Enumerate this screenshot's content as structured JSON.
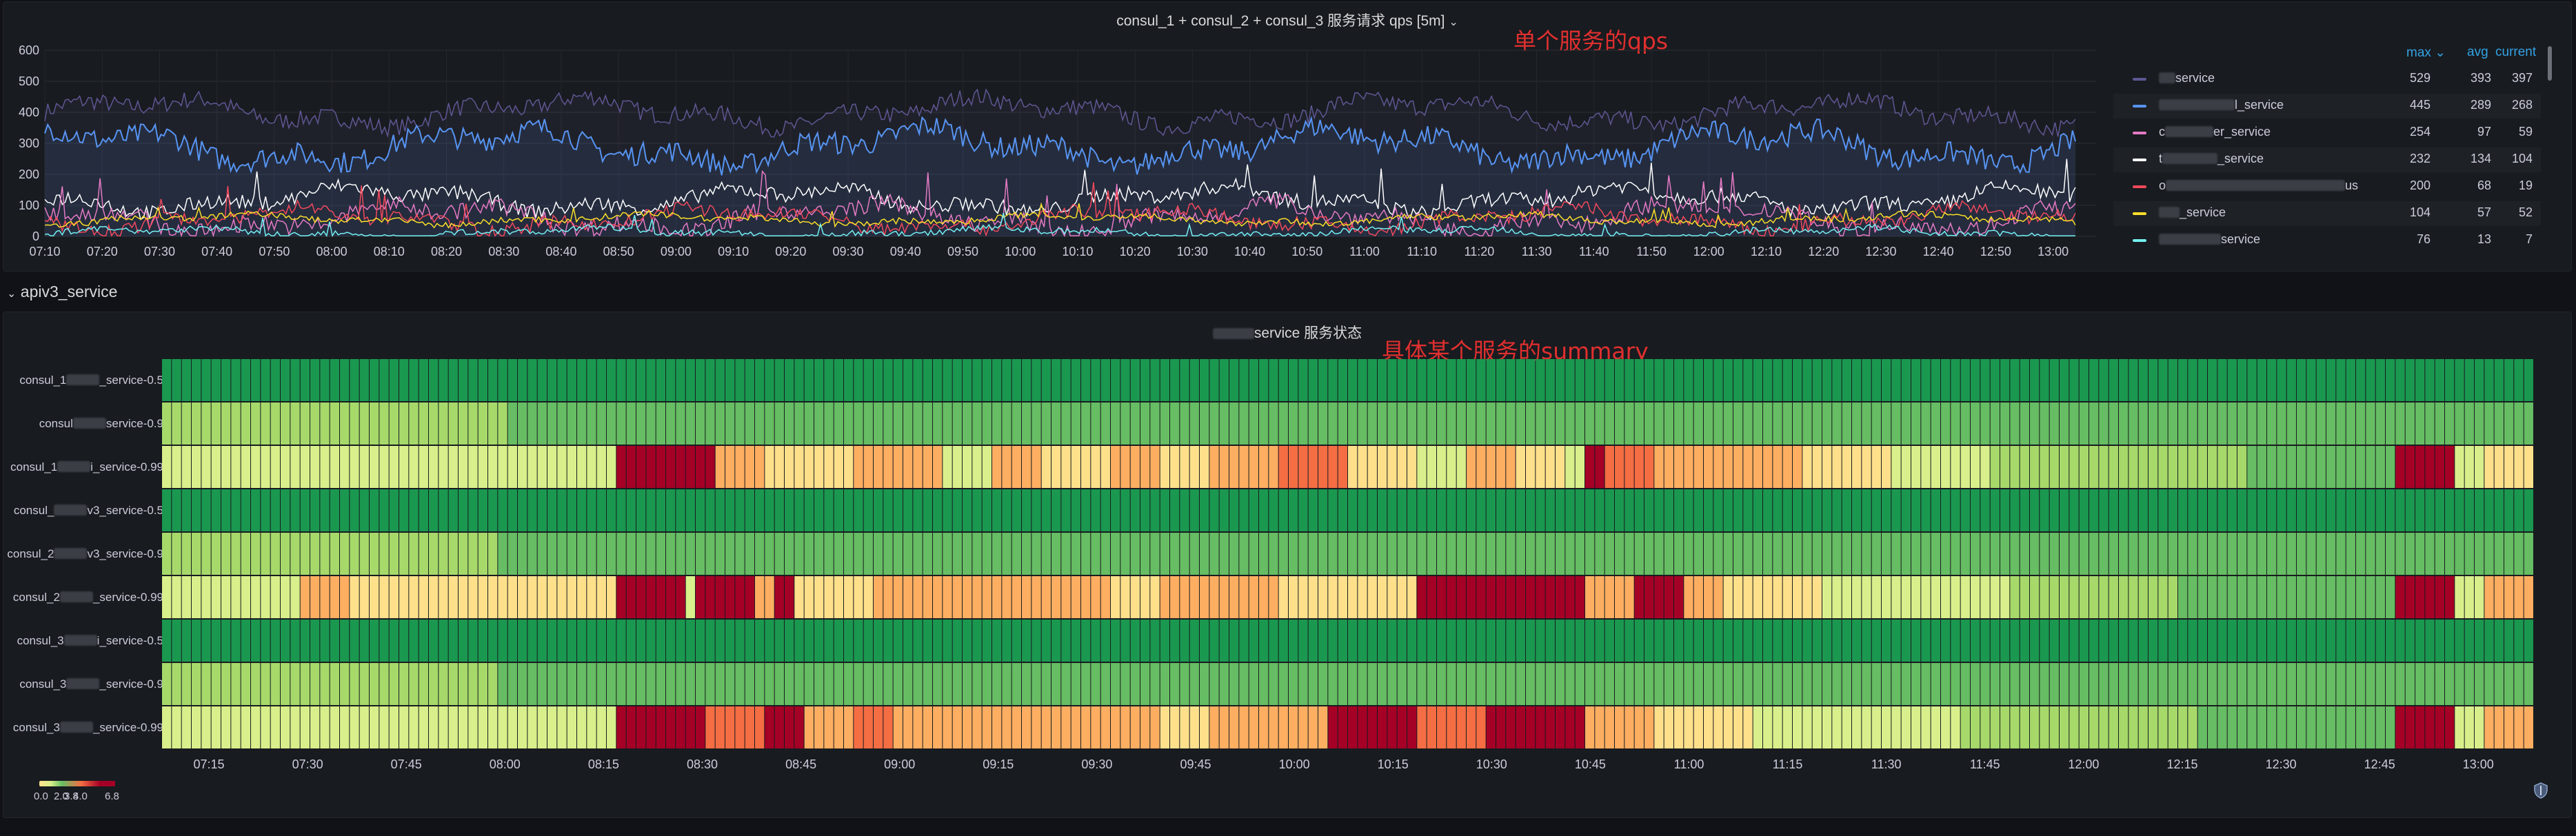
{
  "qps_panel": {
    "title": "consul_1 + consul_2 + consul_3 服务请求 qps [5m]",
    "title_caret": "⌄",
    "annotation": "单个服务的qps",
    "legend": {
      "headers": {
        "max": "max ⌄",
        "avg": "avg",
        "current": "current"
      },
      "rows": [
        {
          "name": "service",
          "blur_w": 24,
          "color": "#5e5794",
          "max": "529",
          "avg": "393",
          "current": "397"
        },
        {
          "name": "l_service",
          "blur_w": 110,
          "color": "#5794f2",
          "max": "445",
          "avg": "289",
          "current": "268"
        },
        {
          "name": "c",
          "blur_w": 70,
          "name2": "er_service",
          "color": "#e57ac3",
          "max": "254",
          "avg": "97",
          "current": "59"
        },
        {
          "name": "t",
          "blur_w": 80,
          "name2": "_service",
          "color": "#ffffff",
          "max": "232",
          "avg": "134",
          "current": "104"
        },
        {
          "name": "o",
          "blur_w": 260,
          "name2": "us",
          "color": "#f2495c",
          "max": "200",
          "avg": "68",
          "current": "19"
        },
        {
          "name": "_service",
          "blur_w": 30,
          "color": "#fade2a",
          "max": "104",
          "avg": "57",
          "current": "52"
        },
        {
          "name": "service",
          "blur_w": 90,
          "color": "#73f0f0",
          "max": "76",
          "avg": "13",
          "current": "7"
        }
      ]
    }
  },
  "section_header": {
    "caret": "⌄",
    "label": "apiv3_service"
  },
  "heatmap_panel": {
    "title_suffix": "service 服务状态",
    "annotation": "具体某个服务的summary",
    "row_labels": [
      {
        "pre": "consul_1",
        "post": "_service-0.5"
      },
      {
        "pre": "consul",
        "post": "service-0.9"
      },
      {
        "pre": "consul_1",
        "post": "i_service-0.99"
      },
      {
        "pre": "consul_",
        "post": "v3_service-0.5"
      },
      {
        "pre": "consul_2",
        "post": "v3_service-0.9"
      },
      {
        "pre": "consul_2",
        "post": "_service-0.99"
      },
      {
        "pre": "consul_3",
        "post": "i_service-0.5"
      },
      {
        "pre": "consul_3",
        "post": "_service-0.9"
      },
      {
        "pre": "consul_3",
        "post": "_service-0.99"
      }
    ],
    "color_scale": {
      "min": "0.0",
      "labels": [
        "2.0",
        "3.8",
        "4.0"
      ],
      "max": "6.8"
    },
    "colors": [
      "#1a9850",
      "#66bd63",
      "#a6d96a",
      "#d9ef8b",
      "#fee08b",
      "#fdae61",
      "#f46d43",
      "#a50026"
    ]
  },
  "chart_data": [
    {
      "type": "line",
      "title": "consul_1 + consul_2 + consul_3 服务请求 qps [5m]",
      "x_ticks": [
        "07:10",
        "07:20",
        "07:30",
        "07:40",
        "07:50",
        "08:00",
        "08:10",
        "08:20",
        "08:30",
        "08:40",
        "08:50",
        "09:00",
        "09:10",
        "09:20",
        "09:30",
        "09:40",
        "09:50",
        "10:00",
        "10:10",
        "10:20",
        "10:30",
        "10:40",
        "10:50",
        "11:00",
        "11:10",
        "11:20",
        "11:30",
        "11:40",
        "11:50",
        "12:00",
        "12:10",
        "12:20",
        "12:30",
        "12:40",
        "12:50",
        "13:00"
      ],
      "y_ticks": [
        0,
        100,
        200,
        300,
        400,
        500,
        600
      ],
      "ylim": [
        0,
        600
      ],
      "grid": true,
      "legend_position": "right",
      "series": [
        {
          "name": "service",
          "stats": {
            "max": 529,
            "avg": 393,
            "current": 397
          }
        },
        {
          "name": "l_service",
          "stats": {
            "max": 445,
            "avg": 289,
            "current": 268
          }
        },
        {
          "name": "er_service",
          "stats": {
            "max": 254,
            "avg": 97,
            "current": 59
          }
        },
        {
          "name": "_service",
          "stats": {
            "max": 232,
            "avg": 134,
            "current": 104
          }
        },
        {
          "name": "us",
          "stats": {
            "max": 200,
            "avg": 68,
            "current": 19
          }
        },
        {
          "name": "_service",
          "stats": {
            "max": 104,
            "avg": 57,
            "current": 52
          }
        },
        {
          "name": "service",
          "stats": {
            "max": 76,
            "avg": 13,
            "current": 7
          }
        }
      ]
    },
    {
      "type": "heatmap",
      "title": "service 服务状态",
      "x_ticks": [
        "07:15",
        "07:30",
        "07:45",
        "08:00",
        "08:15",
        "08:30",
        "08:45",
        "09:00",
        "09:15",
        "09:30",
        "09:45",
        "10:00",
        "10:15",
        "10:30",
        "10:45",
        "11:00",
        "11:15",
        "11:30",
        "11:45",
        "12:00",
        "12:15",
        "12:30",
        "12:45",
        "13:00"
      ],
      "rows": [
        "service-0.5",
        "service-0.9",
        "service-0.99",
        "v3_service-0.5",
        "v3_service-0.9",
        "service-0.99",
        "service-0.5",
        "service-0.9",
        "service-0.99"
      ],
      "color_range": [
        0.0,
        6.8
      ],
      "bands": {
        "row0": [
          [
            0,
            1,
            0
          ]
        ],
        "row1": [
          [
            0,
            0.145,
            2
          ],
          [
            0.145,
            1,
            1
          ]
        ],
        "row2": [
          [
            0,
            0.19,
            3
          ],
          [
            0.19,
            0.235,
            7
          ],
          [
            0.235,
            0.255,
            5
          ],
          [
            0.255,
            0.29,
            4
          ],
          [
            0.29,
            0.33,
            5
          ],
          [
            0.33,
            0.35,
            3
          ],
          [
            0.35,
            0.37,
            5
          ],
          [
            0.37,
            0.4,
            4
          ],
          [
            0.4,
            0.42,
            5
          ],
          [
            0.42,
            0.44,
            4
          ],
          [
            0.44,
            0.47,
            5
          ],
          [
            0.47,
            0.5,
            6
          ],
          [
            0.5,
            0.53,
            4
          ],
          [
            0.53,
            0.55,
            3
          ],
          [
            0.55,
            0.57,
            5
          ],
          [
            0.57,
            0.59,
            4
          ],
          [
            0.59,
            0.6,
            3
          ],
          [
            0.6,
            0.61,
            7
          ],
          [
            0.61,
            0.63,
            6
          ],
          [
            0.63,
            0.64,
            5
          ],
          [
            0.64,
            0.69,
            5
          ],
          [
            0.69,
            0.73,
            4
          ],
          [
            0.73,
            0.77,
            3
          ],
          [
            0.77,
            0.88,
            2
          ],
          [
            0.88,
            0.94,
            1
          ],
          [
            0.94,
            0.965,
            7
          ],
          [
            0.965,
            0.98,
            3
          ],
          [
            0.98,
            1,
            4
          ]
        ],
        "row3": [
          [
            0,
            1,
            0
          ]
        ],
        "row4": [
          [
            0,
            0.14,
            2
          ],
          [
            0.14,
            0.17,
            1
          ],
          [
            0.17,
            1,
            1
          ]
        ],
        "row5": [
          [
            0,
            0.06,
            3
          ],
          [
            0.06,
            0.08,
            5
          ],
          [
            0.08,
            0.19,
            4
          ],
          [
            0.19,
            0.22,
            7
          ],
          [
            0.22,
            0.225,
            3
          ],
          [
            0.225,
            0.25,
            7
          ],
          [
            0.25,
            0.26,
            5
          ],
          [
            0.26,
            0.265,
            7
          ],
          [
            0.265,
            0.3,
            4
          ],
          [
            0.3,
            0.32,
            5
          ],
          [
            0.32,
            0.34,
            5
          ],
          [
            0.34,
            0.37,
            5
          ],
          [
            0.37,
            0.4,
            5
          ],
          [
            0.4,
            0.42,
            4
          ],
          [
            0.42,
            0.47,
            5
          ],
          [
            0.47,
            0.53,
            4
          ],
          [
            0.53,
            0.6,
            7
          ],
          [
            0.6,
            0.62,
            5
          ],
          [
            0.62,
            0.64,
            7
          ],
          [
            0.64,
            0.66,
            5
          ],
          [
            0.66,
            0.7,
            4
          ],
          [
            0.7,
            0.78,
            3
          ],
          [
            0.78,
            0.85,
            2
          ],
          [
            0.85,
            0.94,
            1
          ],
          [
            0.94,
            0.965,
            7
          ],
          [
            0.965,
            0.98,
            3
          ],
          [
            0.98,
            1,
            5
          ]
        ],
        "row6": [
          [
            0,
            1,
            0
          ]
        ],
        "row7": [
          [
            0,
            0.14,
            2
          ],
          [
            0.14,
            1,
            1
          ]
        ],
        "row8": [
          [
            0,
            0.19,
            3
          ],
          [
            0.19,
            0.23,
            7
          ],
          [
            0.23,
            0.255,
            6
          ],
          [
            0.255,
            0.27,
            7
          ],
          [
            0.27,
            0.29,
            5
          ],
          [
            0.29,
            0.31,
            6
          ],
          [
            0.31,
            0.36,
            5
          ],
          [
            0.36,
            0.42,
            5
          ],
          [
            0.42,
            0.44,
            4
          ],
          [
            0.44,
            0.47,
            5
          ],
          [
            0.47,
            0.49,
            5
          ],
          [
            0.49,
            0.53,
            7
          ],
          [
            0.53,
            0.56,
            6
          ],
          [
            0.56,
            0.6,
            7
          ],
          [
            0.6,
            0.63,
            5
          ],
          [
            0.63,
            0.67,
            4
          ],
          [
            0.67,
            0.76,
            3
          ],
          [
            0.76,
            0.86,
            2
          ],
          [
            0.86,
            0.94,
            1
          ],
          [
            0.94,
            0.965,
            7
          ],
          [
            0.965,
            0.98,
            3
          ],
          [
            0.98,
            1,
            5
          ]
        ]
      }
    }
  ]
}
